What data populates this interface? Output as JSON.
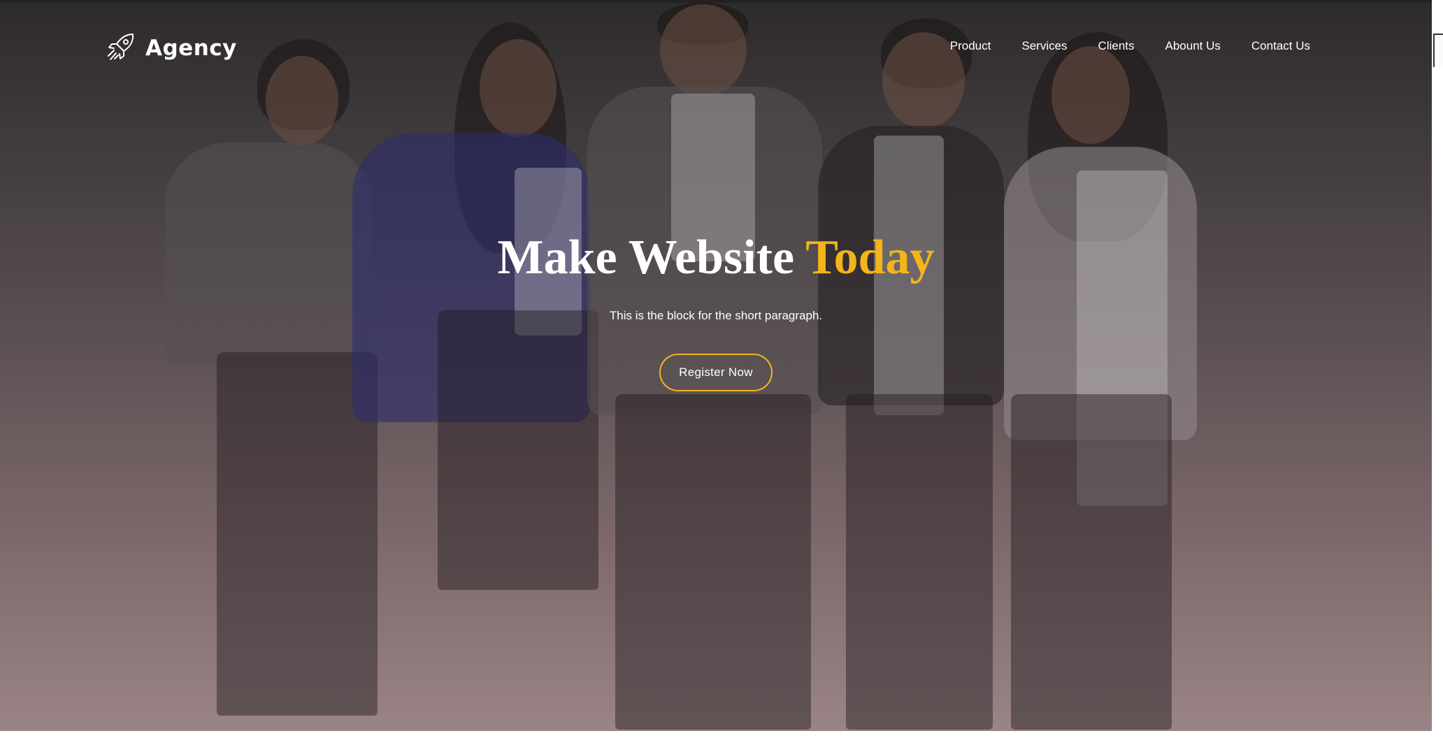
{
  "brand": {
    "logo_icon": "rocket-icon",
    "name": "Agency"
  },
  "nav": {
    "items": [
      {
        "label": "Product"
      },
      {
        "label": "Services"
      },
      {
        "label": "Clients"
      },
      {
        "label": "Abount Us"
      },
      {
        "label": "Contact Us"
      }
    ]
  },
  "hero": {
    "headline_main": "Make Website",
    "headline_accent": "Today",
    "subtitle": "This is the block for the short paragraph.",
    "cta_label": "Register Now"
  },
  "colors": {
    "accent": "#f4b51b",
    "text": "#ffffff",
    "overlay_top": "#2e2b2c",
    "overlay_bottom": "#9a8485"
  }
}
